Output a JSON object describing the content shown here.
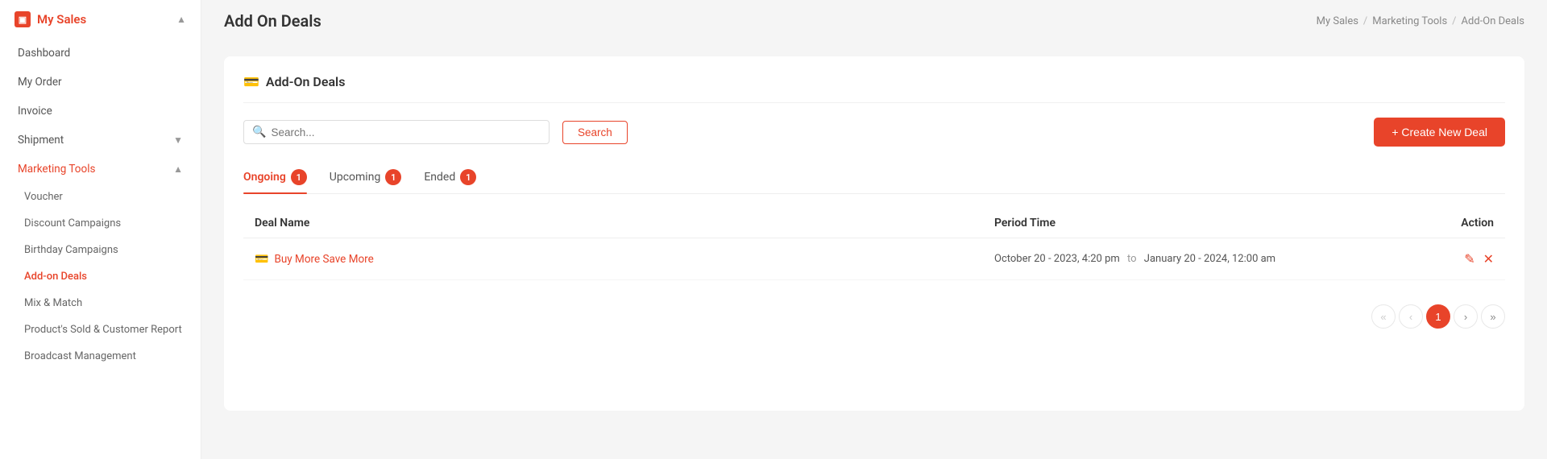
{
  "sidebar": {
    "brand": "My Sales",
    "items": [
      {
        "id": "dashboard",
        "label": "Dashboard",
        "active": false
      },
      {
        "id": "my-order",
        "label": "My Order",
        "active": false
      },
      {
        "id": "invoice",
        "label": "Invoice",
        "active": false
      },
      {
        "id": "shipment",
        "label": "Shipment",
        "active": false,
        "hasChevron": true
      }
    ],
    "marketing_tools": {
      "label": "Marketing Tools",
      "expanded": true,
      "sub_items": [
        {
          "id": "voucher",
          "label": "Voucher",
          "active": false
        },
        {
          "id": "discount-campaigns",
          "label": "Discount Campaigns",
          "active": false
        },
        {
          "id": "birthday-campaigns",
          "label": "Birthday Campaigns",
          "active": false
        },
        {
          "id": "add-on-deals",
          "label": "Add-on Deals",
          "active": true
        },
        {
          "id": "mix-match",
          "label": "Mix & Match",
          "active": false
        },
        {
          "id": "products-sold",
          "label": "Product's Sold & Customer Report",
          "active": false
        },
        {
          "id": "broadcast",
          "label": "Broadcast Management",
          "active": false
        }
      ]
    }
  },
  "breadcrumb": {
    "items": [
      "My Sales",
      "Marketing Tools",
      "Add-On Deals"
    ],
    "separators": [
      "/",
      "/"
    ]
  },
  "page": {
    "title": "Add On Deals",
    "card_title": "Add-On Deals",
    "search_placeholder": "Search...",
    "search_btn_label": "Search",
    "create_btn_label": "+ Create New Deal"
  },
  "tabs": [
    {
      "id": "ongoing",
      "label": "Ongoing",
      "badge": "1",
      "active": true
    },
    {
      "id": "upcoming",
      "label": "Upcoming",
      "badge": "1",
      "active": false
    },
    {
      "id": "ended",
      "label": "Ended",
      "badge": "1",
      "active": false
    }
  ],
  "table": {
    "columns": [
      "Deal Name",
      "Period Time",
      "Action"
    ],
    "rows": [
      {
        "deal_name": "Buy More Save More",
        "period_start": "October 20 - 2023, 4:20 pm",
        "to": "to",
        "period_end": "January 20 - 2024, 12:00 am"
      }
    ]
  },
  "pagination": {
    "first_label": "«",
    "prev_label": "‹",
    "current": "1",
    "next_label": "›",
    "last_label": "»"
  }
}
